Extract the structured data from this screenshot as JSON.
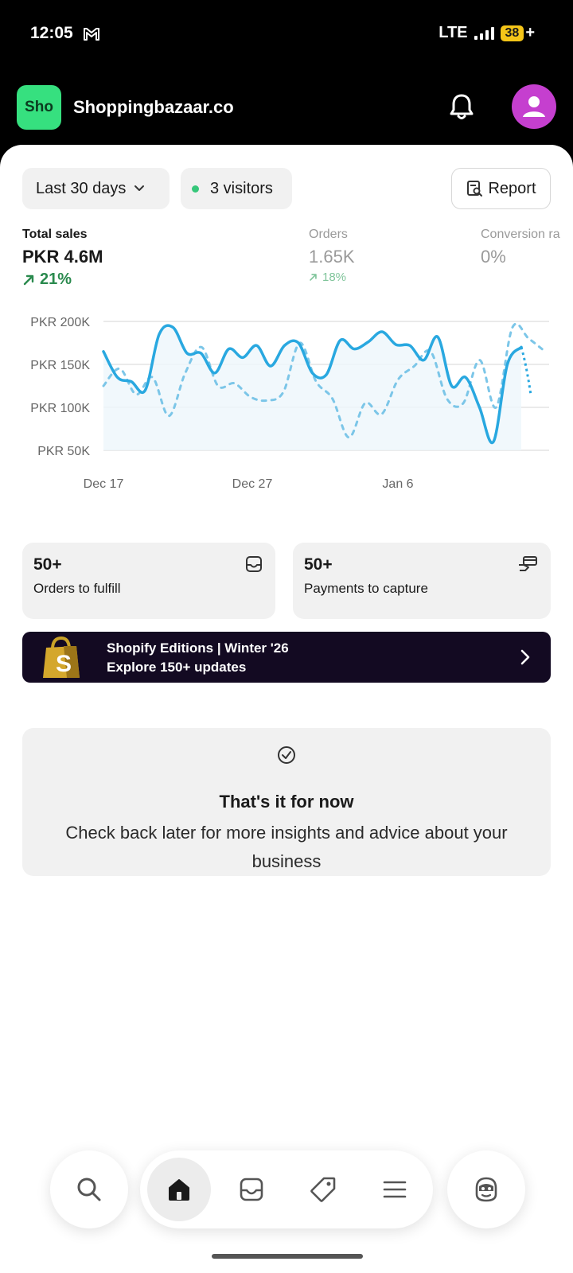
{
  "status_bar": {
    "time": "12:05",
    "network": "LTE",
    "battery": "38",
    "battery_suffix": "+"
  },
  "header": {
    "store_logo_text": "Sho",
    "store_name": "Shoppingbazaar.co",
    "logo_color": "#36e07f",
    "avatar_color": "#c53fcf"
  },
  "filters": {
    "date_range": "Last 30 days",
    "visitors": "3 visitors",
    "report_label": "Report"
  },
  "metrics": {
    "total_sales": {
      "label": "Total sales",
      "value": "PKR 4.6M",
      "change": "21%"
    },
    "orders": {
      "label": "Orders",
      "value": "1.65K",
      "change": "18%"
    },
    "conversion": {
      "label": "Conversion ra",
      "value": "0%"
    }
  },
  "chart_data": {
    "type": "line",
    "y_ticks": [
      "PKR 200K",
      "PKR 150K",
      "PKR 100K",
      "PKR 50K"
    ],
    "ylim": [
      50000,
      200000
    ],
    "x_ticks": [
      "Dec 17",
      "Dec 27",
      "Jan 6"
    ],
    "grid": true,
    "series": [
      {
        "style": "solid",
        "color": "#29a8e0",
        "values": [
          165000,
          135000,
          130000,
          120000,
          185000,
          193000,
          163000,
          163000,
          140000,
          168000,
          158000,
          172000,
          148000,
          172000,
          175000,
          140000,
          138000,
          178000,
          168000,
          176000,
          188000,
          173000,
          172000,
          155000,
          182000,
          125000,
          135000,
          100000,
          60000,
          150000,
          170000
        ]
      },
      {
        "style": "dotted",
        "color": "#7cc6e8",
        "values": [
          125000,
          145000,
          115000,
          135000,
          90000,
          140000,
          170000,
          125000,
          128000,
          112000,
          108000,
          118000,
          175000,
          130000,
          110000,
          65000,
          105000,
          92000,
          132000,
          148000,
          165000,
          110000,
          105000,
          155000,
          100000,
          193000,
          180000,
          165000
        ]
      }
    ]
  },
  "cards": {
    "fulfill": {
      "count": "50+",
      "label": "Orders to fulfill"
    },
    "payments": {
      "count": "50+",
      "label": "Payments to capture"
    }
  },
  "banner": {
    "line1": "Shopify Editions | Winter '26",
    "line2": "Explore 150+ updates",
    "bag_letter": "S"
  },
  "empty_state": {
    "title": "That's it for now",
    "text": "Check back later for more insights and advice about your business"
  },
  "nav": {
    "icons": [
      "search-icon",
      "home-icon",
      "inbox-icon",
      "tag-icon",
      "menu-icon",
      "assistant-icon"
    ]
  }
}
